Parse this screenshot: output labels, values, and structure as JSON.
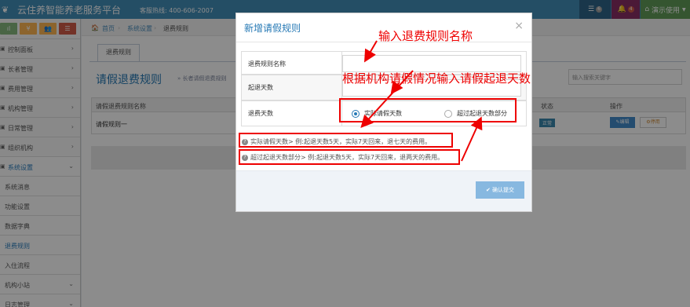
{
  "topbar": {
    "app_title": "云住养智能养老服务平台",
    "hotline": "客服热线: 400-606-2007",
    "tasks_count": "6",
    "alerts_count": "4",
    "user_label": "演示使用"
  },
  "sidebar": {
    "shortcuts": [
      "ıl",
      "¥",
      "👥",
      "☰"
    ],
    "items": [
      {
        "label": "控制面板"
      },
      {
        "label": "长者管理"
      },
      {
        "label": "费用管理"
      },
      {
        "label": "机构管理"
      },
      {
        "label": "日常管理"
      },
      {
        "label": "组织机构"
      },
      {
        "label": "系统设置"
      },
      {
        "label": "系统消息"
      },
      {
        "label": "功能设置"
      },
      {
        "label": "数据字典"
      },
      {
        "label": "退费规则"
      },
      {
        "label": "入住流程"
      },
      {
        "label": "机构小站"
      },
      {
        "label": "日志管理"
      }
    ]
  },
  "breadcrumb": {
    "home": "首页",
    "level1": "系统设置",
    "level2": "退费规则"
  },
  "main": {
    "tab_label": "退费规则",
    "page_title": "请假退费规则",
    "page_sub": "» 长者请假退费规则",
    "search_placeholder": "输入搜索关键字",
    "table": {
      "headers": {
        "name": "请假退费规则名称",
        "status": "状态",
        "actions": "操作"
      },
      "rows": [
        {
          "name": "请假规则一",
          "status": "正常",
          "edit": "编辑",
          "disable": "停用"
        }
      ]
    }
  },
  "modal": {
    "title": "新增请假规则",
    "close": "×",
    "fields": {
      "name_label": "退费规则名称",
      "start_days_label": "起退天数",
      "refund_days_label": "退费天数",
      "radio_actual": "实际请假天数",
      "radio_exceed": "超过起退天数部分"
    },
    "hints": [
      "实际请假天数> 例:起退天数5天，实际7天回来，退七天的费用。",
      "超过起退天数部分> 例:起退天数5天，实际7天回来，退两天的费用。"
    ],
    "submit_label": "确认提交"
  },
  "annotations": {
    "enter_name": "输入退费规则名称",
    "enter_days": "根据机构请假情况输入请假起退天数"
  },
  "colors": {
    "header_blue": "#438eb9",
    "title_blue": "#2679b5",
    "annotation_red": "#e00000"
  }
}
